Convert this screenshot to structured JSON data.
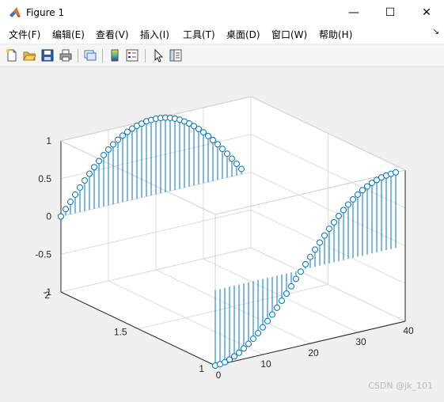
{
  "window": {
    "title": "Figure 1",
    "controls": {
      "minimize": "—",
      "maximize": "☐",
      "close": "✕"
    }
  },
  "menubar": {
    "items": [
      {
        "label": "文件(F)"
      },
      {
        "label": "编辑(E)"
      },
      {
        "label": "查看(V)"
      },
      {
        "label": "插入(I)"
      },
      {
        "label": "工具(T)"
      },
      {
        "label": "桌面(D)"
      },
      {
        "label": "窗口(W)"
      },
      {
        "label": "帮助(H)"
      }
    ]
  },
  "toolbar": {
    "buttons": [
      "new-figure-icon",
      "open-folder-icon",
      "save-icon",
      "print-icon",
      "link-plot-icon",
      "colorbar-icon",
      "legend-icon",
      "pointer-icon",
      "property-inspector-icon"
    ]
  },
  "watermark": "CSDN @jk_101",
  "colors": {
    "stem": "#0072bd",
    "grid": "#dcdcdc",
    "axes_bg": "#ffffff",
    "figure_bg": "#f0f0f0"
  },
  "chart_data": {
    "type": "stem3",
    "title": "",
    "grid": true,
    "box": true,
    "x_ticks": [
      "0",
      "10",
      "20",
      "30",
      "40"
    ],
    "y_ticks": [
      "1",
      "1.5",
      "2"
    ],
    "z_ticks": [
      "-1",
      "-0.5",
      "0",
      "0.5",
      "1"
    ],
    "xlim": [
      0,
      40
    ],
    "ylim": [
      1,
      2
    ],
    "zlim": [
      -1,
      1
    ],
    "series": [
      {
        "y": 1,
        "function": "cos",
        "x": [
          0,
          1,
          2,
          3,
          4,
          5,
          6,
          7,
          8,
          9,
          10,
          11,
          12,
          13,
          14,
          15,
          16,
          17,
          18,
          19,
          20,
          21,
          22,
          23,
          24,
          25,
          26,
          27,
          27,
          28,
          29,
          30,
          31,
          32,
          33,
          34,
          35,
          36,
          37,
          38
        ],
        "z": [
          -1.0,
          -0.996,
          -0.984,
          -0.964,
          -0.937,
          -0.903,
          -0.862,
          -0.815,
          -0.762,
          -0.703,
          -0.64,
          -0.572,
          -0.5,
          -0.425,
          -0.347,
          -0.267,
          -0.185,
          -0.102,
          -0.02,
          0.063,
          0.145,
          0.227,
          0.306,
          0.384,
          0.459,
          0.53,
          0.598,
          0.662,
          0.662,
          0.721,
          0.775,
          0.823,
          0.866,
          0.903,
          0.934,
          0.958,
          0.976,
          0.988,
          0.995,
          1.0
        ]
      },
      {
        "y": 2,
        "function": "sin",
        "x": [
          0,
          1,
          2,
          3,
          4,
          5,
          6,
          7,
          8,
          9,
          10,
          11,
          12,
          13,
          14,
          15,
          16,
          17,
          18,
          19,
          20,
          21,
          22,
          23,
          24,
          25,
          26,
          27,
          28,
          29,
          30,
          31,
          32,
          33,
          34,
          35,
          36,
          37,
          38
        ],
        "z": [
          0.0,
          0.082,
          0.164,
          0.245,
          0.324,
          0.402,
          0.477,
          0.549,
          0.616,
          0.68,
          0.738,
          0.791,
          0.838,
          0.879,
          0.914,
          0.942,
          0.964,
          0.979,
          0.995,
          0.998,
          1.0,
          0.995,
          0.985,
          0.967,
          0.943,
          0.913,
          0.876,
          0.834,
          0.785,
          0.732,
          0.673,
          0.61,
          0.542,
          0.47,
          0.395,
          0.317,
          0.236,
          0.154,
          0.071
        ]
      }
    ]
  }
}
